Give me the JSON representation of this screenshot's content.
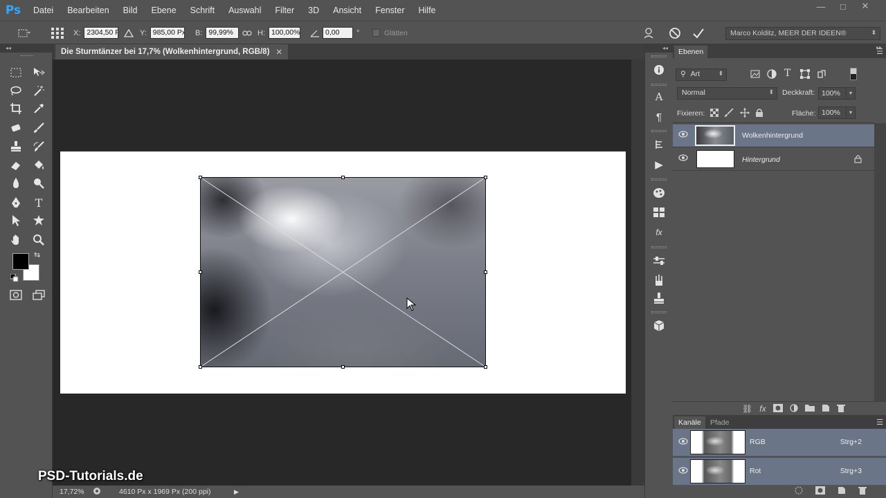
{
  "app": {
    "logo": "Ps"
  },
  "menu": [
    "Datei",
    "Bearbeiten",
    "Bild",
    "Ebene",
    "Schrift",
    "Auswahl",
    "Filter",
    "3D",
    "Ansicht",
    "Fenster",
    "Hilfe"
  ],
  "window_controls": {
    "minimize": "—",
    "maximize": "□",
    "close": "✕"
  },
  "options_bar": {
    "x_label": "X:",
    "x_value": "2304,50 P",
    "y_label": "Y:",
    "y_value": "985,00 Px",
    "w_label": "B:",
    "w_value": "99,99%",
    "h_label": "H:",
    "h_value": "100,00%",
    "angle_value": "0,00",
    "angle_unit": "°",
    "smooth_label": "Glätten",
    "workspace": "Marco Kolditz, MEER DER IDEEN®"
  },
  "document": {
    "tab_title": "Die Sturmtänzer bei 17,7% (Wolkenhintergrund, RGB/8)",
    "tab_close": "✕"
  },
  "status": {
    "zoom": "17,72%",
    "doc_info": "4610 Px x 1969 Px (200 ppi)"
  },
  "watermark": "PSD-Tutorials.de",
  "layers_panel": {
    "tab": "Ebenen",
    "filter_kind": "Art",
    "blend_mode": "Normal",
    "opacity_label": "Deckkraft:",
    "opacity_value": "100%",
    "lock_label": "Fixieren:",
    "fill_label": "Fläche:",
    "fill_value": "100%",
    "layers": [
      {
        "name": "Wolkenhintergrund",
        "selected": true
      },
      {
        "name": "Hintergrund",
        "selected": false,
        "locked": true
      }
    ]
  },
  "channels_panel": {
    "tabs": [
      "Kanäle",
      "Pfade"
    ],
    "channels": [
      {
        "name": "RGB",
        "shortcut": "Strg+2"
      },
      {
        "name": "Rot",
        "shortcut": "Strg+3"
      }
    ]
  },
  "colors": {
    "panel_bg": "#535353",
    "canvas_bg": "#282828",
    "selected_layer": "#6a7588",
    "ps_blue": "#31a8ff"
  }
}
